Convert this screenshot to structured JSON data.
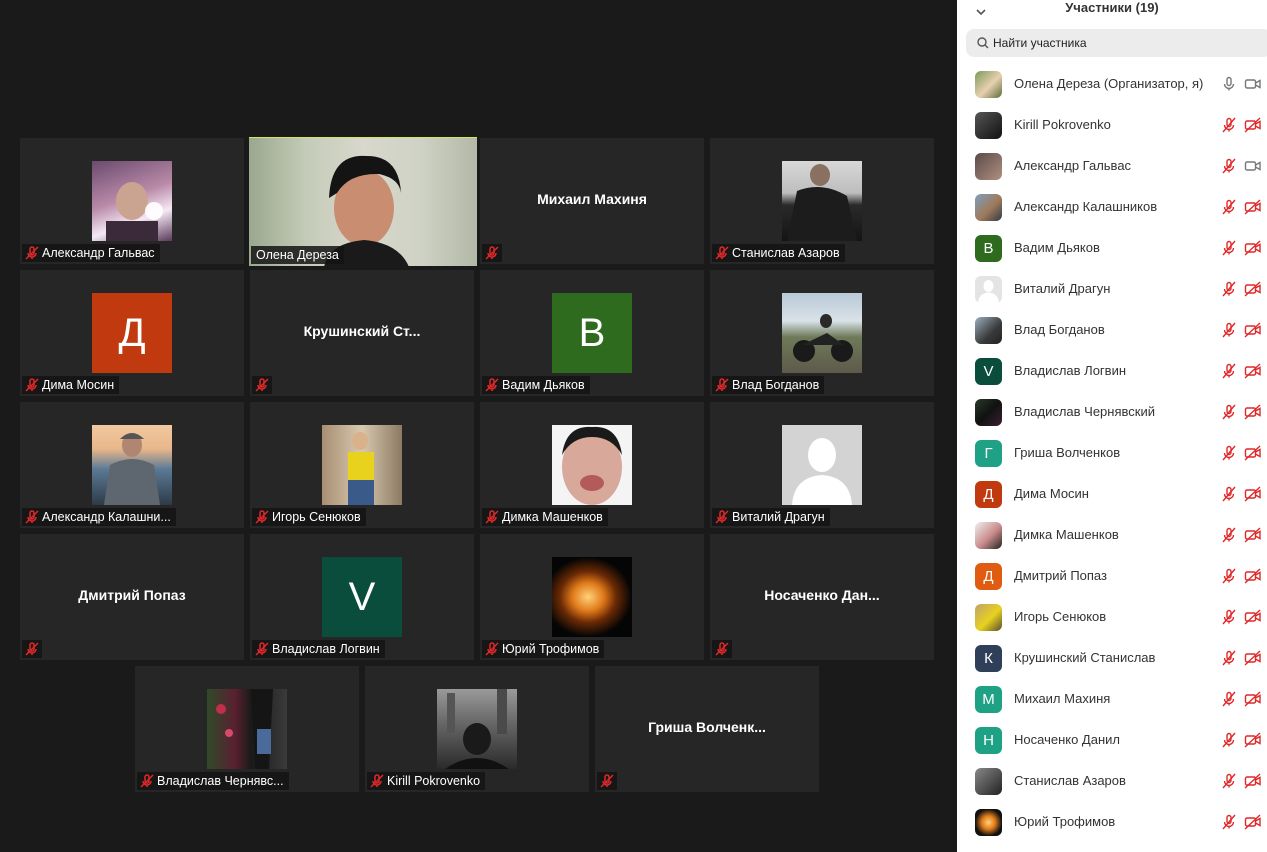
{
  "panel": {
    "title": "Участники (19)",
    "search_placeholder": "Найти участника",
    "participants": [
      {
        "name": "Олена Дереза (Организатор, я)",
        "avatar": "photo",
        "mic": "on",
        "cam": "on"
      },
      {
        "name": "Kirill Pokrovenko",
        "avatar": "photo",
        "mic": "muted",
        "cam": "off"
      },
      {
        "name": "Александр Гальвас",
        "avatar": "photo",
        "mic": "muted",
        "cam": "on"
      },
      {
        "name": "Александр Калашников",
        "avatar": "photo",
        "mic": "muted",
        "cam": "off"
      },
      {
        "name": "Вадим Дьяков",
        "avatar": "letter",
        "initial": "В",
        "color": "#2e6b1f",
        "mic": "muted",
        "cam": "off"
      },
      {
        "name": "Виталий Драгун",
        "avatar": "default",
        "mic": "muted",
        "cam": "off"
      },
      {
        "name": "Влад Богданов",
        "avatar": "photo",
        "mic": "muted",
        "cam": "off"
      },
      {
        "name": "Владислав Логвин",
        "avatar": "letter",
        "initial": "V",
        "color": "#0b4d3c",
        "mic": "muted",
        "cam": "off"
      },
      {
        "name": "Владислав Чернявский",
        "avatar": "photo",
        "mic": "muted",
        "cam": "off"
      },
      {
        "name": "Гриша Волченков",
        "avatar": "letter",
        "initial": "Г",
        "color": "#1fa186",
        "mic": "muted",
        "cam": "off"
      },
      {
        "name": "Дима Мосин",
        "avatar": "letter",
        "initial": "Д",
        "color": "#c0390f",
        "mic": "muted",
        "cam": "off"
      },
      {
        "name": "Димка Машенков",
        "avatar": "photo",
        "mic": "muted",
        "cam": "off"
      },
      {
        "name": "Дмитрий Попаз",
        "avatar": "letter",
        "initial": "Д",
        "color": "#e05c10",
        "mic": "muted",
        "cam": "off"
      },
      {
        "name": "Игорь Сенюков",
        "avatar": "photo",
        "mic": "muted",
        "cam": "off"
      },
      {
        "name": "Крушинский Станислав",
        "avatar": "letter",
        "initial": "К",
        "color": "#2f3f5a",
        "mic": "muted",
        "cam": "off"
      },
      {
        "name": "Михаил Махиня",
        "avatar": "letter",
        "initial": "М",
        "color": "#1fa186",
        "mic": "muted",
        "cam": "off"
      },
      {
        "name": "Носаченко Данил",
        "avatar": "letter",
        "initial": "Н",
        "color": "#1fa186",
        "mic": "muted",
        "cam": "off"
      },
      {
        "name": "Станислав Азаров",
        "avatar": "photo",
        "mic": "muted",
        "cam": "off"
      },
      {
        "name": "Юрий Трофимов",
        "avatar": "photo",
        "mic": "muted",
        "cam": "off"
      }
    ]
  },
  "tiles": [
    {
      "name": "Александр Гальвас",
      "display": "photo",
      "tag": "Александр Гальвас"
    },
    {
      "name": "Олена Дереза",
      "display": "video",
      "tag": "Олена Дереза",
      "active": true
    },
    {
      "name": "Михаил Махиня",
      "display": "name",
      "big_name": "Михаил Махиня"
    },
    {
      "name": "Станислав Азаров",
      "display": "photo",
      "tag": "Станислав Азаров"
    },
    {
      "name": "Дима Мосин",
      "display": "letter",
      "initial": "Д",
      "color": "#c0390f",
      "tag": "Дима Мосин"
    },
    {
      "name": "Крушинский Станислав",
      "display": "name",
      "big_name": "Крушинский  Ст..."
    },
    {
      "name": "Вадим Дьяков",
      "display": "letter",
      "initial": "В",
      "color": "#2e6b1f",
      "tag": "Вадим Дьяков"
    },
    {
      "name": "Влад Богданов",
      "display": "photo",
      "tag": "Влад Богданов"
    },
    {
      "name": "Александр Калашников",
      "display": "photo",
      "tag": "Александр Калашни..."
    },
    {
      "name": "Игорь Сенюков",
      "display": "photo",
      "tag": "Игорь Сенюков"
    },
    {
      "name": "Димка Машенков",
      "display": "photo",
      "tag": "Димка Машенков"
    },
    {
      "name": "Виталий Драгун",
      "display": "default",
      "tag": "Виталий Драгун"
    },
    {
      "name": "Дмитрий Попаз",
      "display": "name",
      "big_name": "Дмитрий Попаз"
    },
    {
      "name": "Владислав Логвин",
      "display": "letter",
      "initial": "V",
      "color": "#0b4d3c",
      "tag": "Владислав Логвин"
    },
    {
      "name": "Юрий Трофимов",
      "display": "photo",
      "tag": "Юрий Трофимов"
    },
    {
      "name": "Носаченко Данил",
      "display": "name",
      "big_name": "Носаченко  Дан..."
    },
    {
      "name": "Владислав Чернявский",
      "display": "photo",
      "tag": "Владислав Чернявс..."
    },
    {
      "name": "Kirill Pokrovenko",
      "display": "photo",
      "tag": "Kirill Pokrovenko"
    },
    {
      "name": "Гриша Волченков",
      "display": "name",
      "big_name": "Гриша  Волченк..."
    }
  ]
}
